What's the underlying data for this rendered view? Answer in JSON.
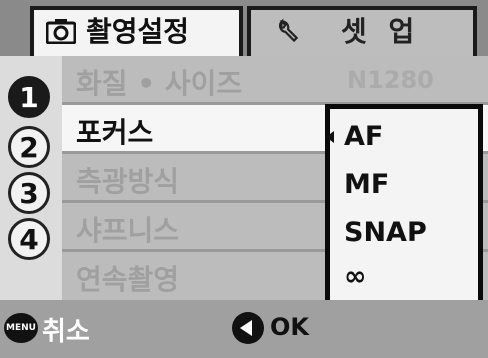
{
  "tabs": [
    {
      "label": "촬영설정",
      "icon": "camera-icon",
      "active": true
    },
    {
      "label": "셋 업",
      "icon": "wrench-icon",
      "active": false
    }
  ],
  "steps": [
    "1",
    "2",
    "3",
    "4"
  ],
  "menu": {
    "items": [
      {
        "label": "화질 • 사이즈",
        "value": "N1280",
        "state": "disabled"
      },
      {
        "label": "포커스",
        "value": "",
        "state": "selected"
      },
      {
        "label": "측광방식",
        "value": "",
        "state": "disabled"
      },
      {
        "label": "샤프니스",
        "value": "",
        "state": "disabled"
      },
      {
        "label": "연속촬영",
        "value": "",
        "state": "disabled"
      }
    ]
  },
  "popup": {
    "options": [
      "AF",
      "MF",
      "SNAP",
      "∞"
    ],
    "selected_index": 0
  },
  "bottom": {
    "menu_key": "MENU",
    "cancel_label": "취소",
    "ok_label": "OK"
  }
}
